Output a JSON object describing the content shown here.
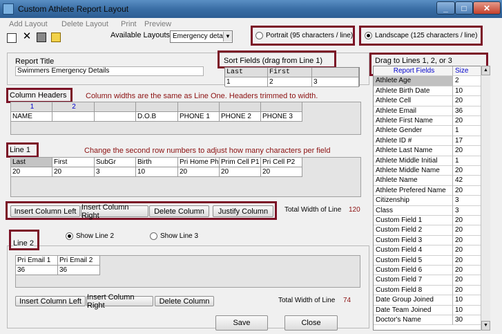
{
  "window": {
    "title": "Custom Athlete Report Layout"
  },
  "menu": [
    "Add Layout",
    "Delete Layout",
    "Print",
    "Preview"
  ],
  "available_layouts": {
    "label": "Available Layouts",
    "value": "Emergency deta"
  },
  "orientation": {
    "portrait_label": "Portrait (95 characters / line)",
    "landscape_label": "Landscape (125 characters / line)",
    "selected": "landscape"
  },
  "report_title": {
    "label": "Report Title",
    "value": "Swimmers Emergency Details"
  },
  "sort_fields": {
    "label": "Sort Fields  (drag from Line 1)",
    "headers": [
      "Last",
      "First",
      ""
    ],
    "numbers": [
      "1",
      "2",
      "3"
    ]
  },
  "column_headers": {
    "label": "Column Headers",
    "note": "Column widths are the same as Line One.  Headers trimmed to width.",
    "numbers": [
      "1",
      "2",
      "",
      "",
      "",
      "",
      ""
    ],
    "names": [
      "NAME",
      "",
      "",
      "D.O.B",
      "PHONE 1",
      "PHONE 2",
      "PHONE 3"
    ]
  },
  "line1": {
    "label": "Line 1",
    "note": "Change the second row numbers to adjust how many characters per field",
    "fields": [
      "Last",
      "First",
      "SubGr",
      "Birth",
      "Pri Home Pho",
      "Prim Cell P1",
      "Pri Cell P2"
    ],
    "widths": [
      "20",
      "20",
      "3",
      "10",
      "20",
      "20",
      "20"
    ]
  },
  "line1_buttons": {
    "insert_left": "Insert Column Left",
    "insert_right": "Insert Column Right",
    "delete": "Delete Column",
    "justify": "Justify Column"
  },
  "line1_total": {
    "label": "Total Width of Line",
    "value": "120"
  },
  "show_line": {
    "line2_label": "Show Line 2",
    "line3_label": "Show Line 3",
    "selected": "line2"
  },
  "line2": {
    "label": "Line 2",
    "fields": [
      "Pri Email 1",
      "Pri Email 2"
    ],
    "widths": [
      "36",
      "36"
    ]
  },
  "line2_buttons": {
    "insert_left": "Insert Column Left",
    "insert_right": "Insert Column Right",
    "delete": "Delete Column"
  },
  "line2_total": {
    "label": "Total Width of Line",
    "value": "74"
  },
  "footer": {
    "save": "Save",
    "close": "Close"
  },
  "drag_panel": {
    "label": "Drag to Lines 1, 2, or 3",
    "col_field": "Report Fields",
    "col_size": "Size",
    "rows": [
      {
        "name": "Athlete Age",
        "size": "2"
      },
      {
        "name": "Athlete Birth Date",
        "size": "10"
      },
      {
        "name": "Athlete Cell",
        "size": "20"
      },
      {
        "name": "Athlete Email",
        "size": "36"
      },
      {
        "name": "Athlete First Name",
        "size": "20"
      },
      {
        "name": "Athlete Gender",
        "size": "1"
      },
      {
        "name": "Athlete ID #",
        "size": "17"
      },
      {
        "name": "Athlete Last Name",
        "size": "20"
      },
      {
        "name": "Athlete Middle Initial",
        "size": "1"
      },
      {
        "name": "Athlete Middle Name",
        "size": "20"
      },
      {
        "name": "Athlete Name",
        "size": "42"
      },
      {
        "name": "Athlete Prefered Name",
        "size": "20"
      },
      {
        "name": "Citizenship",
        "size": "3"
      },
      {
        "name": "Class",
        "size": "3"
      },
      {
        "name": "Custom Field 1",
        "size": "20"
      },
      {
        "name": "Custom Field 2",
        "size": "20"
      },
      {
        "name": "Custom Field 3",
        "size": "20"
      },
      {
        "name": "Custom Field 4",
        "size": "20"
      },
      {
        "name": "Custom Field 5",
        "size": "20"
      },
      {
        "name": "Custom Field 6",
        "size": "20"
      },
      {
        "name": "Custom Field 7",
        "size": "20"
      },
      {
        "name": "Custom Field 8",
        "size": "20"
      },
      {
        "name": "Date Group Joined",
        "size": "10"
      },
      {
        "name": "Date Team Joined",
        "size": "10"
      },
      {
        "name": "Doctor's Name",
        "size": "30"
      }
    ]
  }
}
